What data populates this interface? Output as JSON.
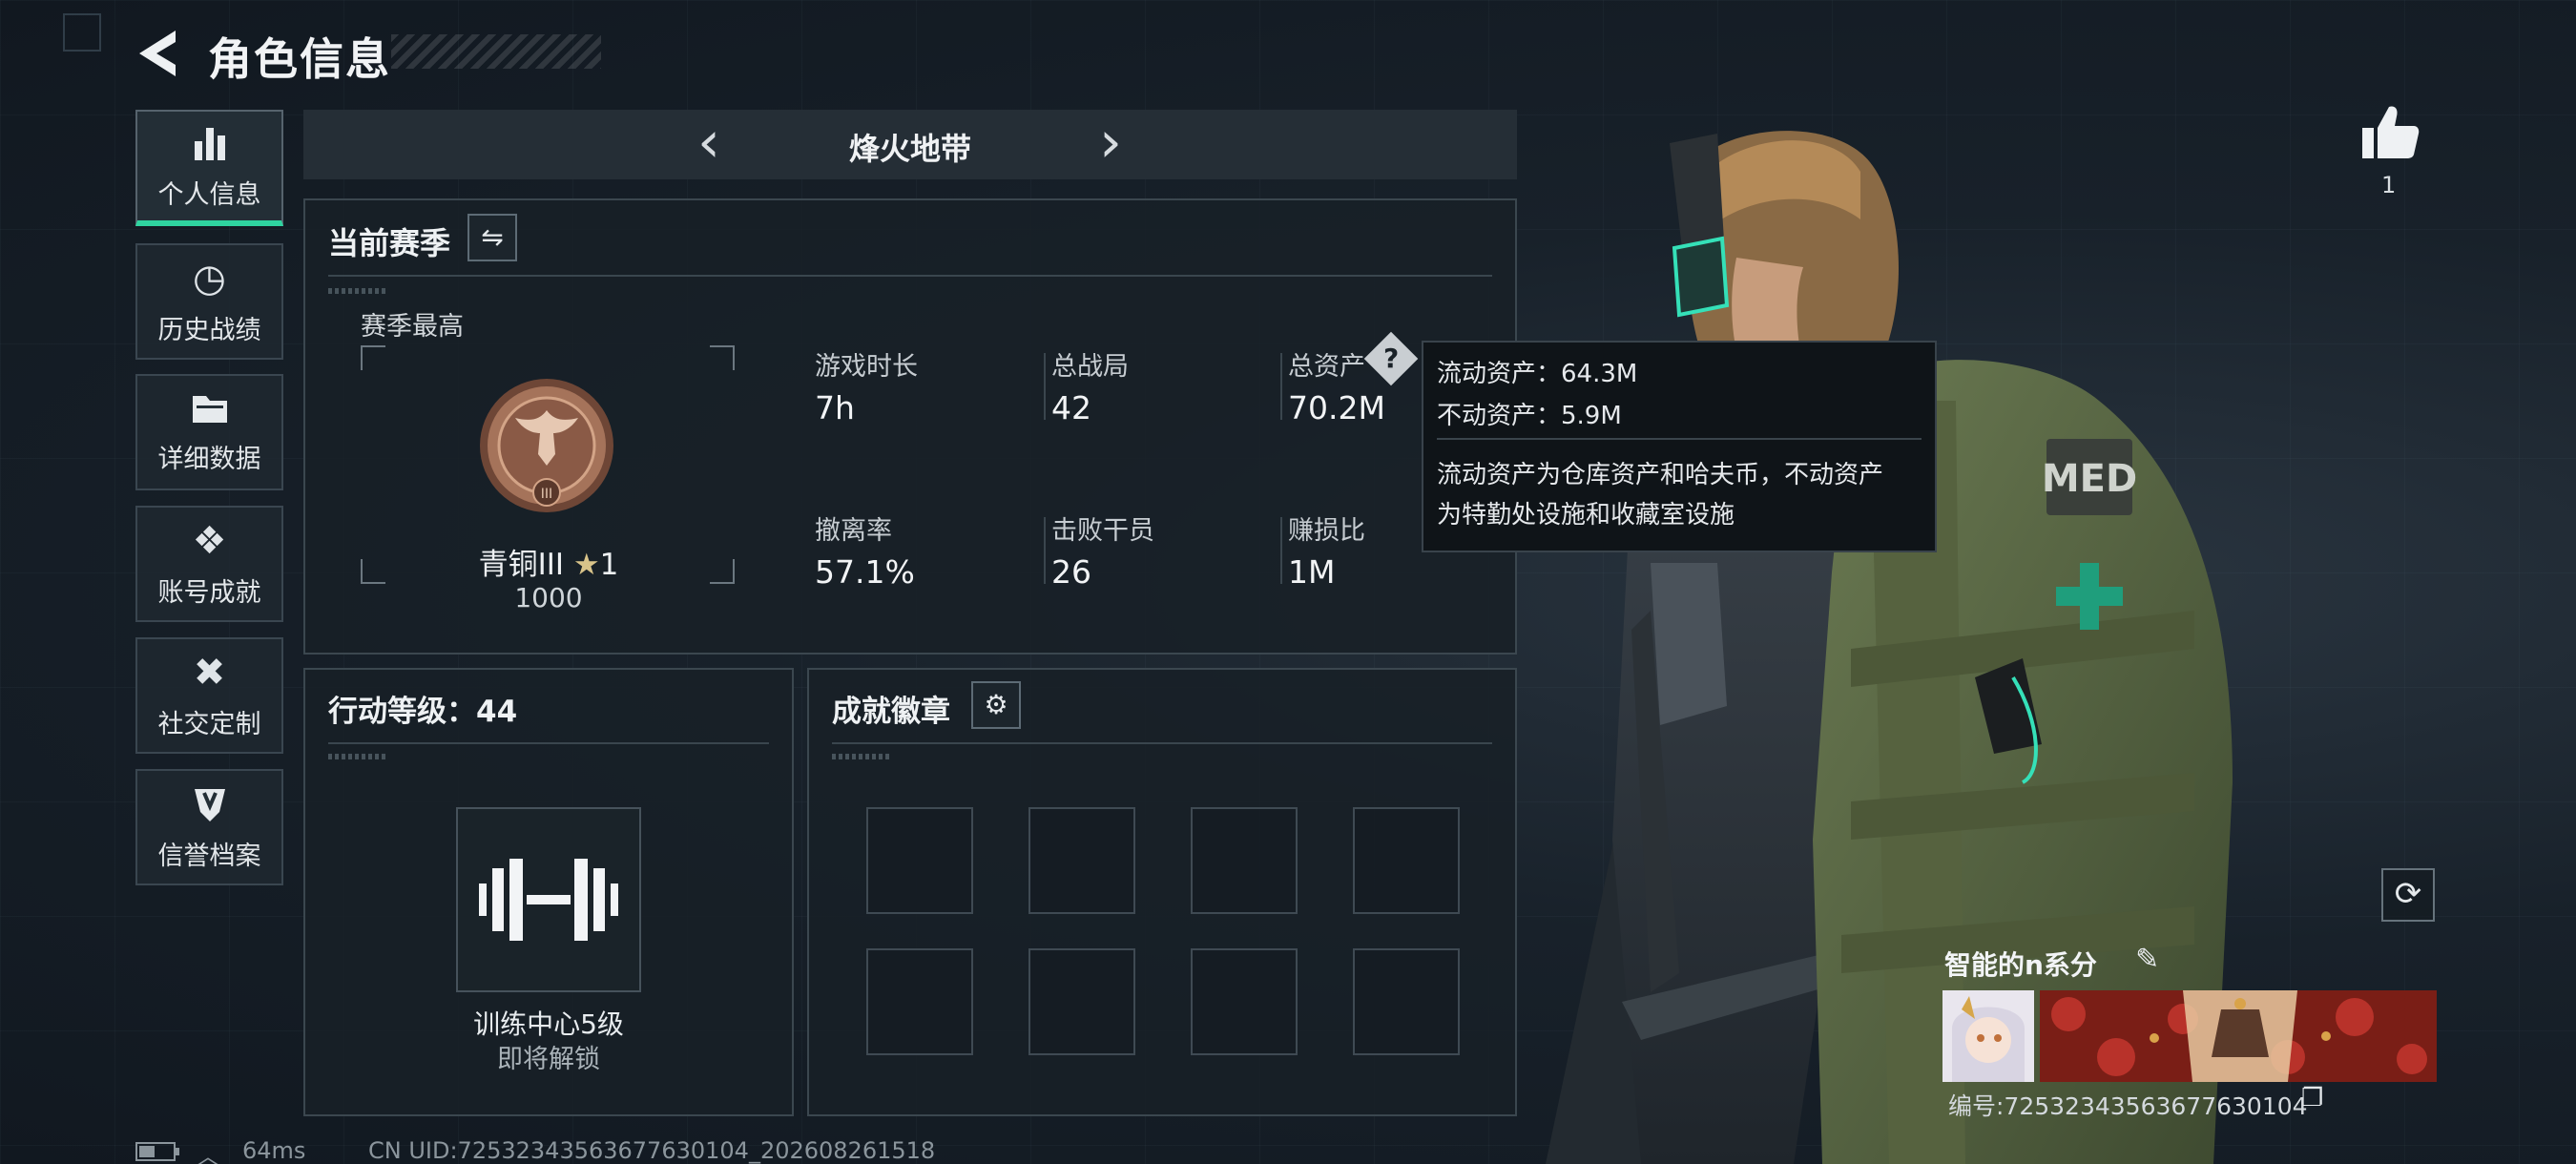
{
  "header": {
    "title": "角色信息"
  },
  "sidebar": {
    "items": [
      {
        "label": "个人信息",
        "icon": "bar-chart-icon",
        "active": true
      },
      {
        "label": "历史战绩",
        "icon": "history-icon",
        "active": false
      },
      {
        "label": "详细数据",
        "icon": "folder-icon",
        "active": false
      },
      {
        "label": "账号成就",
        "icon": "achievement-icon",
        "active": false
      },
      {
        "label": "社交定制",
        "icon": "tools-icon",
        "active": false
      },
      {
        "label": "信誉档案",
        "icon": "shield-icon",
        "active": false
      }
    ]
  },
  "mode": {
    "title": "烽火地带"
  },
  "season": {
    "title": "当前赛季",
    "best_label": "赛季最高",
    "rank_name": "青铜III",
    "rank_stars": "1",
    "rank_points": "1000",
    "stats": [
      {
        "label": "游戏时长",
        "value": "7h"
      },
      {
        "label": "总战局",
        "value": "42"
      },
      {
        "label": "总资产",
        "value": "70.2M"
      },
      {
        "label": "撤离率",
        "value": "57.1%"
      },
      {
        "label": "击败干员",
        "value": "26"
      },
      {
        "label": "赚损比",
        "value": "1M"
      }
    ]
  },
  "tooltip": {
    "liquid": "流动资产：64.3M",
    "fixed": "不动资产：5.9M",
    "desc_line1": "流动资产为仓库资产和哈夫币，不动资产",
    "desc_line2": "为特勤处设施和收藏室设施"
  },
  "level": {
    "title": "行动等级：44",
    "unlock_name": "训练中心5级",
    "unlock_status": "即将解锁"
  },
  "medals": {
    "title": "成就徽章",
    "slots": 8
  },
  "likes": {
    "count": "1"
  },
  "card": {
    "name": "智能的n系分",
    "uid": "编号:7253234356367763010​4"
  },
  "footer": {
    "ping": "64ms",
    "uid_line": "CN UID:72532343563677630104_202608261518"
  },
  "colors": {
    "accent": "#2fd4a0",
    "bronze": "#a5735a",
    "panel": "#182027"
  }
}
